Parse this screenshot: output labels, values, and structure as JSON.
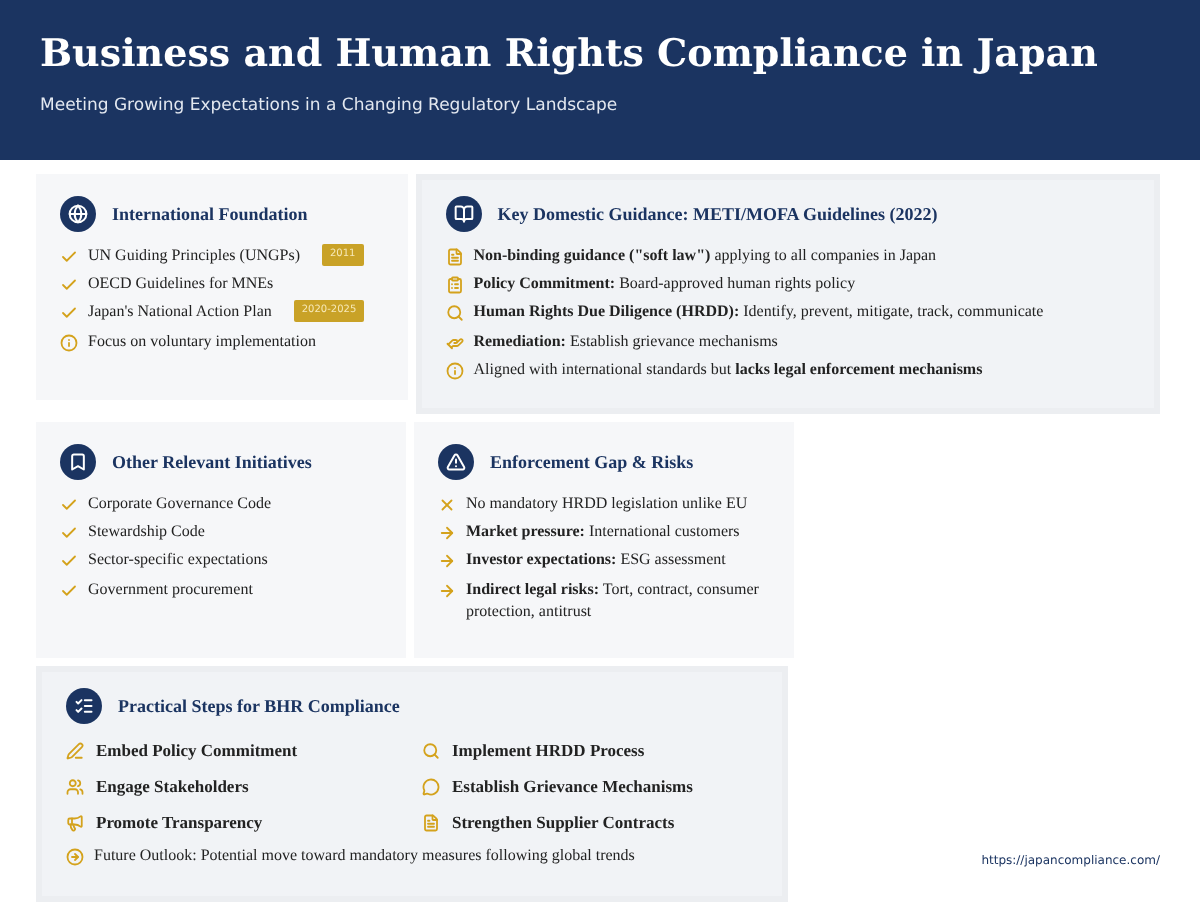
{
  "header": {
    "title": "Business and Human Rights Compliance in Japan",
    "subtitle": "Meeting Growing Expectations in a Changing Regulatory Landscape"
  },
  "cards": [
    {
      "title": "International Foundation",
      "items": [
        {
          "kind": "check",
          "text": "UN Guiding Principles (UNGPs)",
          "badge": "2011"
        },
        {
          "kind": "check",
          "text": "OECD Guidelines for MNEs"
        },
        {
          "kind": "check",
          "text": "Japan's National Action Plan",
          "badge": "2020-2025"
        },
        {
          "kind": "info",
          "text": "Focus on voluntary implementation"
        }
      ]
    },
    {
      "title": "Key Domestic Guidance: METI/MOFA Guidelines (2022)",
      "items": [
        {
          "kind": "file",
          "text": "**Non-binding guidance (\"soft law\")** applying to all companies in Japan"
        },
        {
          "kind": "clipboard",
          "text": "**Policy Commitment:** Board-approved human rights policy"
        },
        {
          "kind": "search",
          "text": "**Human Rights Due Diligence (HRDD):** Identify, prevent, mitigate, track, communicate"
        },
        {
          "kind": "hand",
          "text": "**Remediation:** Establish grievance mechanisms"
        },
        {
          "kind": "info",
          "text": "Aligned with international standards but **lacks legal enforcement mechanisms**"
        }
      ]
    },
    {
      "title": "Other Relevant Initiatives",
      "items": [
        {
          "kind": "check",
          "text": "Corporate Governance Code"
        },
        {
          "kind": "check",
          "text": "Stewardship Code"
        },
        {
          "kind": "check",
          "text": "Sector-specific expectations"
        },
        {
          "kind": "check",
          "text": "Government procurement"
        }
      ]
    },
    {
      "title": "Enforcement Gap & Risks",
      "items": [
        {
          "kind": "cross",
          "text": "No mandatory HRDD legislation unlike EU"
        },
        {
          "kind": "arrow",
          "text": "**Market pressure:** International customers"
        },
        {
          "kind": "arrow",
          "text": "**Investor expectations:** ESG assessment"
        },
        {
          "kind": "arrow",
          "text": "**Indirect legal risks:** Tort, contract, consumer protection, antitrust"
        }
      ]
    }
  ],
  "steps": {
    "title": "Practical Steps for BHR Compliance",
    "items": [
      {
        "kind": "pen",
        "text": "Embed Policy Commitment"
      },
      {
        "kind": "search",
        "text": "Implement HRDD Process"
      },
      {
        "kind": "people",
        "text": "Engage Stakeholders"
      },
      {
        "kind": "chat",
        "text": "Establish Grievance Mechanisms"
      },
      {
        "kind": "megaphone",
        "text": "Promote Transparency"
      },
      {
        "kind": "file",
        "text": "Strengthen Supplier Contracts"
      }
    ],
    "outlook": {
      "kind": "arrow-circle",
      "text": "Future Outlook: Potential move toward mandatory measures following global trends"
    }
  },
  "footer": {
    "url": "https://japancompliance.com/"
  }
}
